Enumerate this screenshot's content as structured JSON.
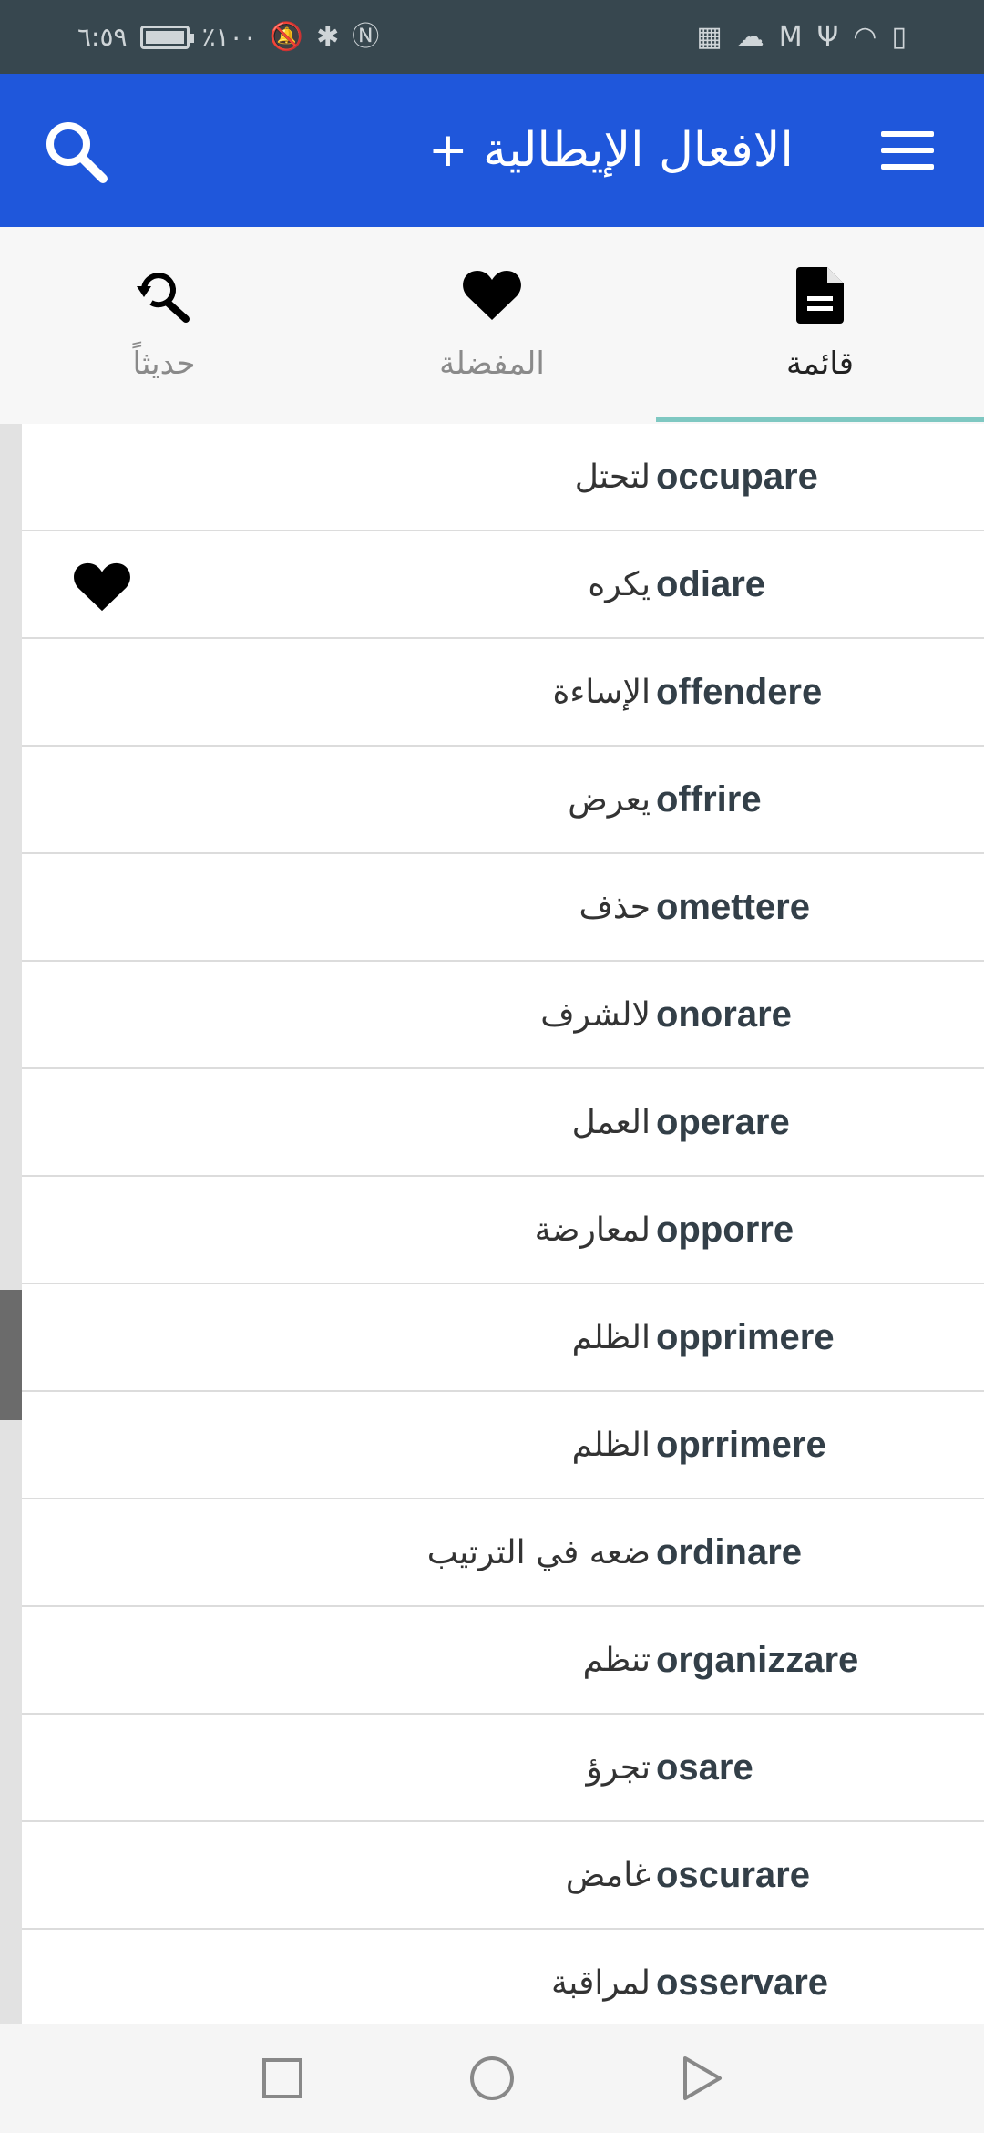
{
  "status_bar": {
    "time": "٦:٥٩",
    "battery_percent": "٪١٠٠",
    "left_icons": [
      "battery-charging-icon",
      "bell-off-icon",
      "bluetooth-icon",
      "nfc-icon"
    ],
    "right_icons": [
      "calendar-icon",
      "cloud-icon",
      "gmail-icon",
      "usb-icon",
      "wifi-icon",
      "alert-icon"
    ]
  },
  "app_bar": {
    "title": "الافعال الإيطالية +",
    "menu_icon": "menu-icon",
    "search_icon": "search-icon",
    "color": "#1f57db"
  },
  "tabs": [
    {
      "label": "قائمة",
      "icon": "document-icon",
      "active": true
    },
    {
      "label": "المفضلة",
      "icon": "heart-icon",
      "active": false
    },
    {
      "label": "حديثاً",
      "icon": "history-search-icon",
      "active": false
    }
  ],
  "verbs": [
    {
      "verb": "occupare",
      "meaning": "لتحتل",
      "favorite": false
    },
    {
      "verb": "odiare",
      "meaning": "يكره",
      "favorite": true
    },
    {
      "verb": "offendere",
      "meaning": "الإساءة",
      "favorite": false
    },
    {
      "verb": "offrire",
      "meaning": "يعرض",
      "favorite": false
    },
    {
      "verb": "omettere",
      "meaning": "حذف",
      "favorite": false
    },
    {
      "verb": "onorare",
      "meaning": "لالشرف",
      "favorite": false
    },
    {
      "verb": "operare",
      "meaning": "العمل",
      "favorite": false
    },
    {
      "verb": "opporre",
      "meaning": "لمعارضة",
      "favorite": false
    },
    {
      "verb": "opprimere",
      "meaning": "الظلم",
      "favorite": false
    },
    {
      "verb": "oprrimere",
      "meaning": "الظلم",
      "favorite": false
    },
    {
      "verb": "ordinare",
      "meaning": "ضعه في الترتيب",
      "favorite": false
    },
    {
      "verb": "organizzare",
      "meaning": "تنظم",
      "favorite": false
    },
    {
      "verb": "osare",
      "meaning": "تجرؤ",
      "favorite": false
    },
    {
      "verb": "oscurare",
      "meaning": "غامض",
      "favorite": false
    },
    {
      "verb": "osservare",
      "meaning": "لمراقبة",
      "favorite": false
    }
  ],
  "nav_bar": {
    "icons": [
      "recents-square-icon",
      "home-circle-icon",
      "back-triangle-icon"
    ]
  }
}
